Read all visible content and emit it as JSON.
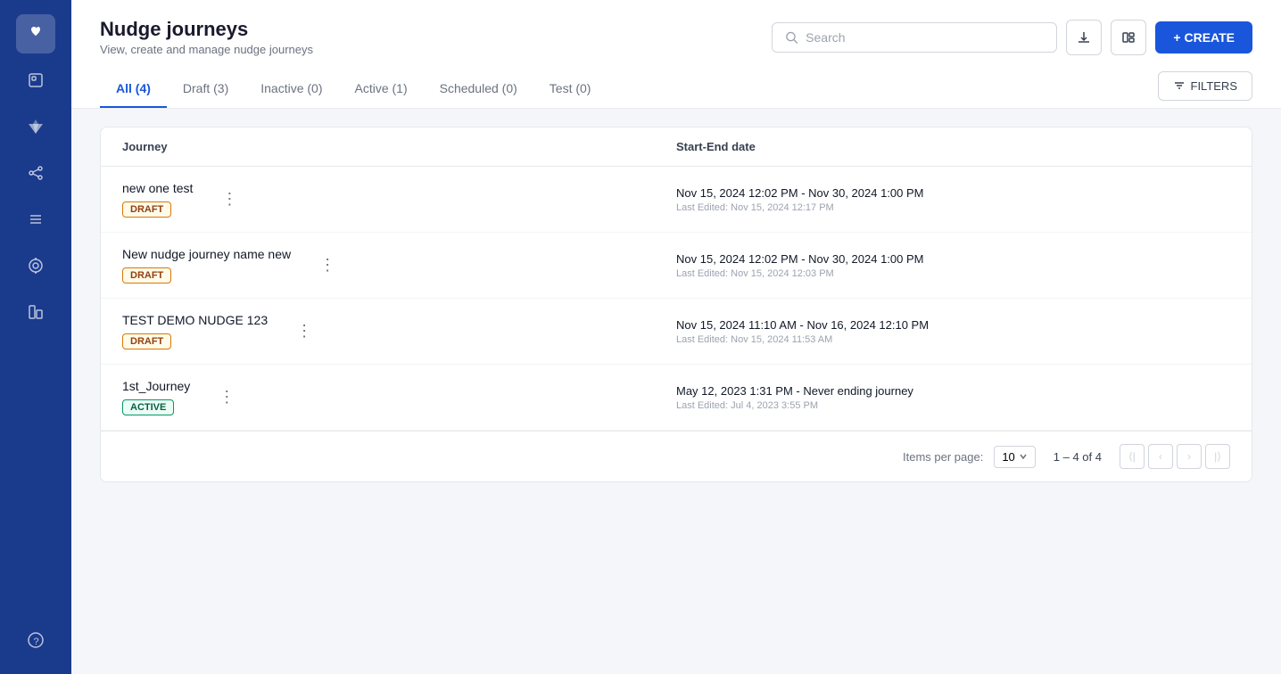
{
  "sidebar": {
    "icons": [
      {
        "name": "apple-icon",
        "symbol": ""
      },
      {
        "name": "box-icon",
        "symbol": "◧"
      },
      {
        "name": "diamond-icon",
        "symbol": "◆"
      },
      {
        "name": "share-icon",
        "symbol": "⤢"
      },
      {
        "name": "list-icon",
        "symbol": "≡"
      },
      {
        "name": "target-icon",
        "symbol": "⊕"
      },
      {
        "name": "chart-icon",
        "symbol": "⊞"
      },
      {
        "name": "help-icon",
        "symbol": "?"
      }
    ]
  },
  "header": {
    "title": "Nudge journeys",
    "subtitle": "View, create and manage nudge journeys",
    "search_placeholder": "Search",
    "create_label": "+ CREATE"
  },
  "tabs": [
    {
      "label": "All (4)",
      "active": true
    },
    {
      "label": "Draft (3)",
      "active": false
    },
    {
      "label": "Inactive (0)",
      "active": false
    },
    {
      "label": "Active (1)",
      "active": false
    },
    {
      "label": "Scheduled (0)",
      "active": false
    },
    {
      "label": "Test (0)",
      "active": false
    }
  ],
  "filters_label": "FILTERS",
  "table": {
    "columns": [
      "Journey",
      "Start-End date"
    ],
    "rows": [
      {
        "name": "new one test",
        "badge": "DRAFT",
        "badge_type": "draft",
        "date_range": "Nov 15, 2024 12:02 PM - Nov 30, 2024 1:00 PM",
        "last_edited": "Last Edited: Nov 15, 2024 12:17 PM"
      },
      {
        "name": "New nudge journey name new",
        "badge": "DRAFT",
        "badge_type": "draft",
        "date_range": "Nov 15, 2024 12:02 PM - Nov 30, 2024 1:00 PM",
        "last_edited": "Last Edited: Nov 15, 2024 12:03 PM"
      },
      {
        "name": "TEST DEMO NUDGE 123",
        "badge": "DRAFT",
        "badge_type": "draft",
        "date_range": "Nov 15, 2024 11:10 AM - Nov 16, 2024 12:10 PM",
        "last_edited": "Last Edited: Nov 15, 2024 11:53 AM"
      },
      {
        "name": "1st_Journey",
        "badge": "ACTIVE",
        "badge_type": "active",
        "date_range": "May 12, 2023 1:31 PM - Never ending journey",
        "last_edited": "Last Edited: Jul 4, 2023 3:55 PM"
      }
    ]
  },
  "pagination": {
    "items_per_page_label": "Items per page:",
    "per_page_value": "10",
    "range": "1 – 4 of 4"
  }
}
